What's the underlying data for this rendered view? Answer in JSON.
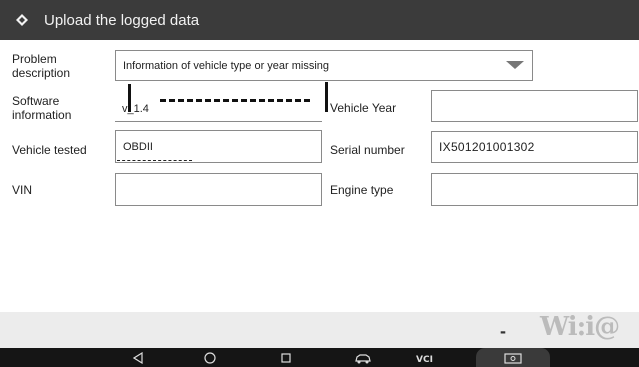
{
  "header": {
    "title": "Upload the logged data",
    "back_icon": "back-diamond-icon"
  },
  "form": {
    "problem_description": {
      "label": "Problem description",
      "value": "Information of vehicle type or year missing"
    },
    "software_information": {
      "label": "Software information",
      "value": "v_1.4"
    },
    "vehicle_year": {
      "label": "Vehicle Year",
      "value": ""
    },
    "vehicle_tested": {
      "label": "Vehicle tested",
      "value": "OBDII"
    },
    "serial_number": {
      "label": "Serial number",
      "value": "IX501201001302"
    },
    "vin": {
      "label": "VIN",
      "value": ""
    },
    "engine_type": {
      "label": "Engine type",
      "value": ""
    }
  },
  "footer": {
    "send_label": "-",
    "watermark": "Wi:i@"
  },
  "colors": {
    "titlebar": "#3b3b3b",
    "navbar": "#151515",
    "strip": "#ececec"
  }
}
